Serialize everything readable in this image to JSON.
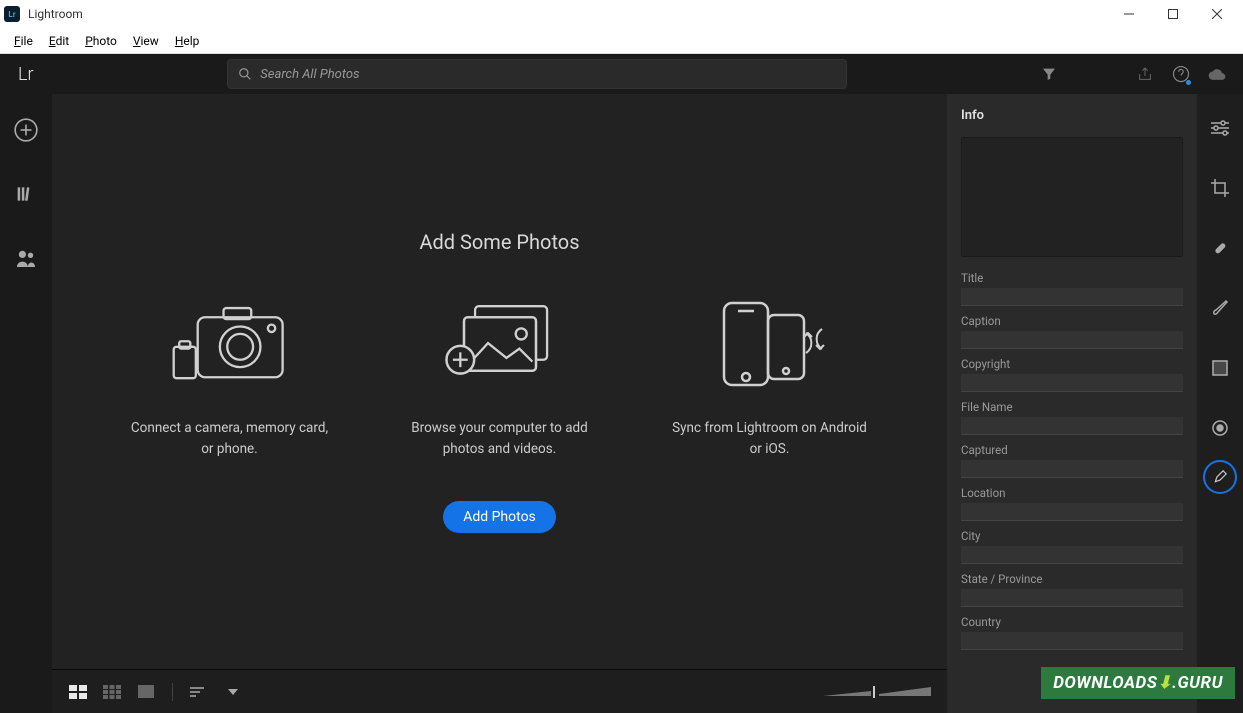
{
  "window": {
    "title": "Lightroom"
  },
  "menu": {
    "items": [
      "File",
      "Edit",
      "Photo",
      "View",
      "Help"
    ]
  },
  "logo": "Lr",
  "search": {
    "placeholder": "Search All Photos"
  },
  "stage": {
    "heading": "Add Some Photos",
    "cards": [
      {
        "text": "Connect a camera, memory card, or phone."
      },
      {
        "text": "Browse your computer to add photos and videos."
      },
      {
        "text": "Sync from Lightroom on Android or iOS."
      }
    ],
    "add_button": "Add Photos"
  },
  "info": {
    "heading": "Info",
    "fields": [
      "Title",
      "Caption",
      "Copyright",
      "File Name",
      "Captured",
      "Location",
      "City",
      "State / Province",
      "Country"
    ]
  },
  "watermark": "DOWNLOADS📥.GURU"
}
